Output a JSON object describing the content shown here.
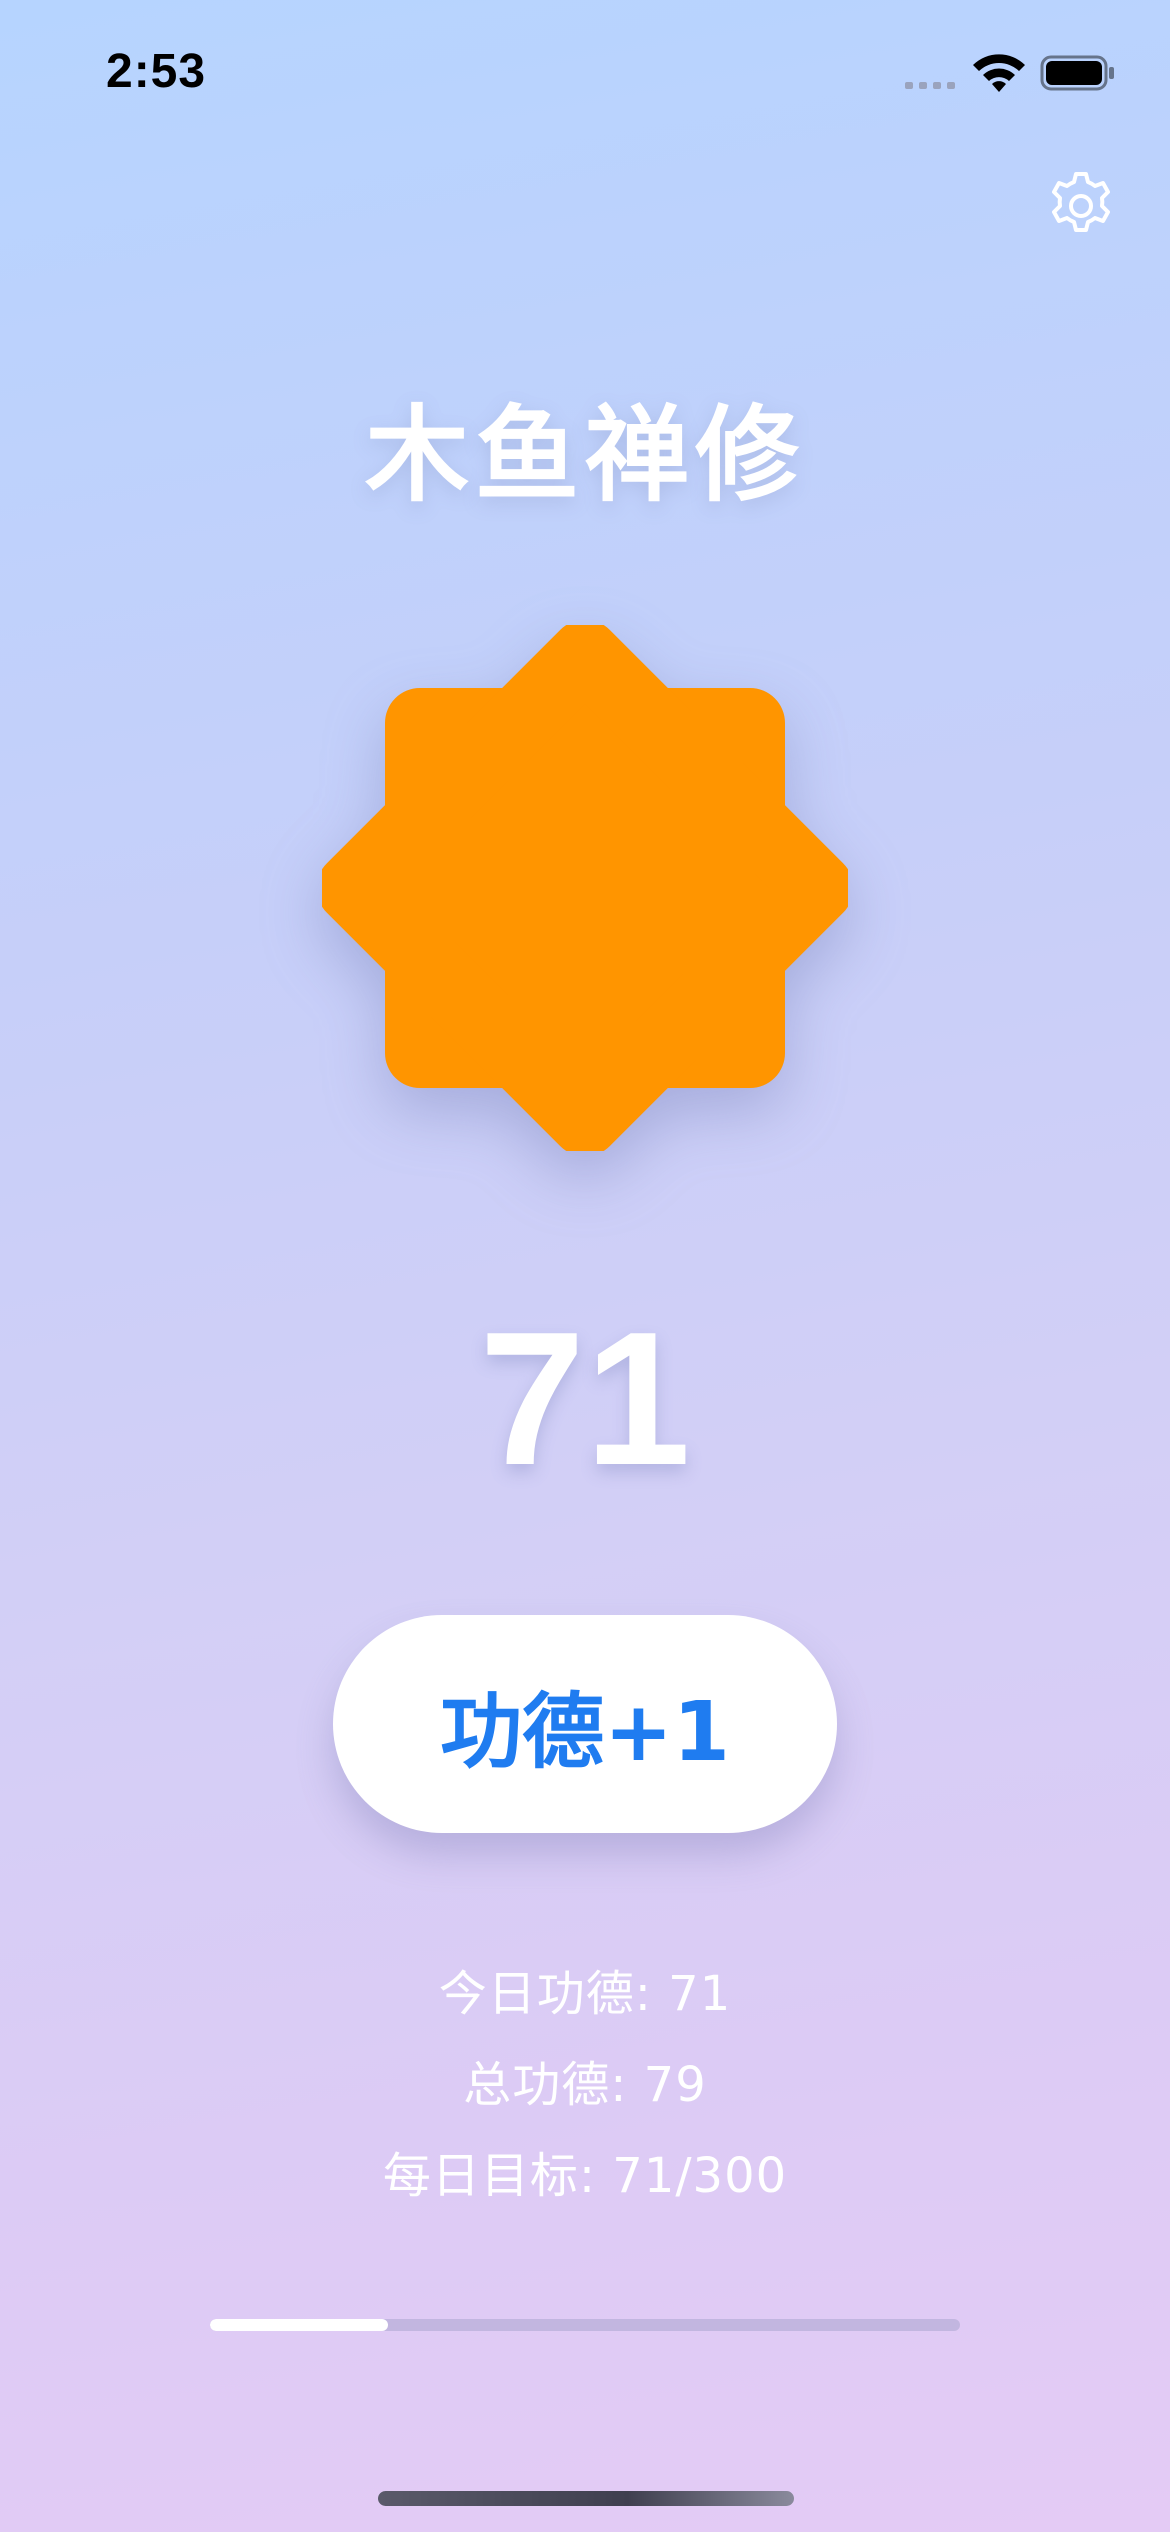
{
  "status_bar": {
    "time": "2:53",
    "icons": [
      "signal-icon",
      "wifi-icon",
      "battery-icon"
    ]
  },
  "header": {
    "settings_icon": "gear-icon"
  },
  "title": "木鱼禅修",
  "wooden_fish": {
    "icon": "wooden-fish-icon",
    "color": "#ff9500"
  },
  "counter": "71",
  "merit_button": {
    "label": "功德+1",
    "color": "#1f7cf0"
  },
  "stats": {
    "today": "今日功德: 71",
    "total": "总功德: 79",
    "goal": "每日目标: 71/300"
  },
  "progress": {
    "value": 71,
    "max": 300
  }
}
